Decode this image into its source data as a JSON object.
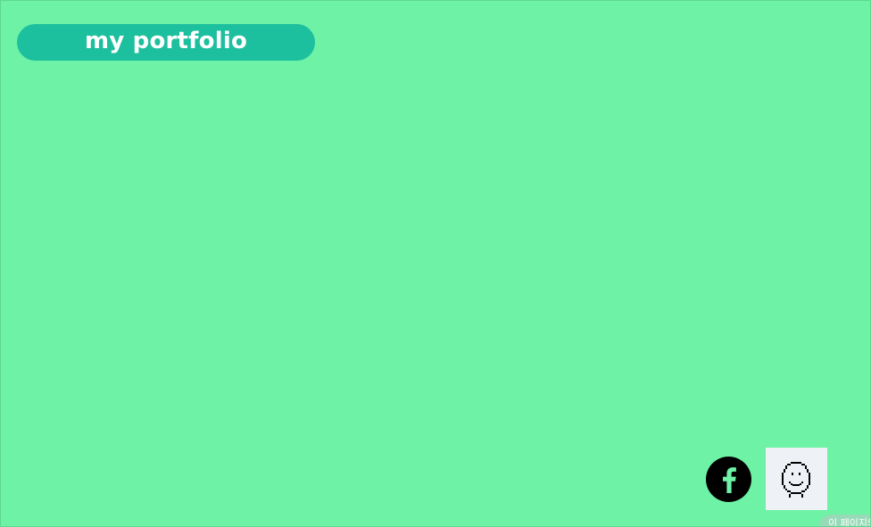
{
  "page": {
    "background_color": "#6df2a6"
  },
  "header": {
    "title": "my portfolio",
    "pill_color": "#1cbf9e"
  },
  "social": {
    "facebook_icon": "facebook-icon",
    "facebook_color": "#000000",
    "avatar_icon": "pixel-smiley-face-icon",
    "avatar_background": "#eef1f6"
  },
  "notice": {
    "text": "이 페이지의",
    "color": "#9bd9b8"
  }
}
